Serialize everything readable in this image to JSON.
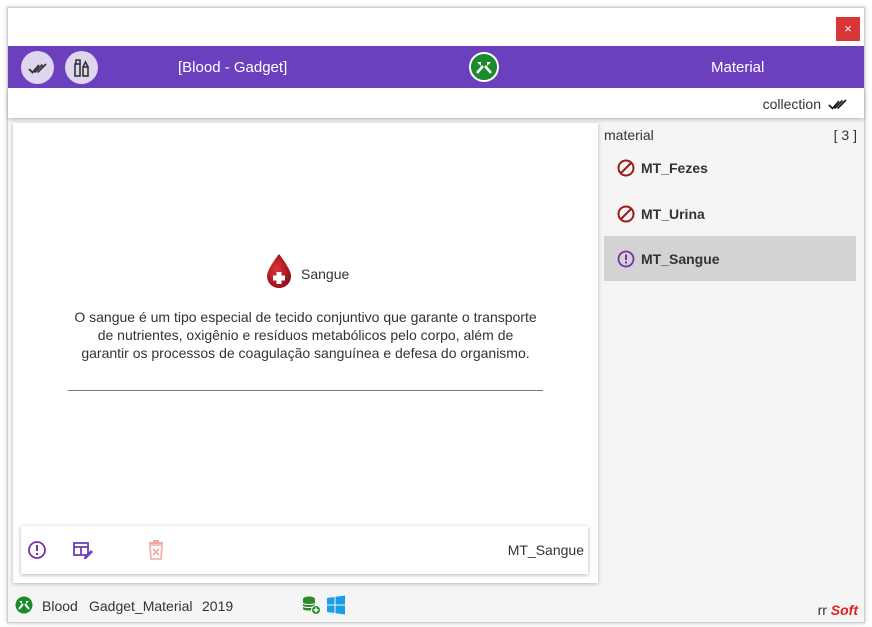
{
  "titlebar": {
    "close_label": "×"
  },
  "header": {
    "title": "[Blood - Gadget]",
    "right_label": "Material",
    "icons": [
      "double-check-icon",
      "tools-icon",
      "app-logo-icon"
    ]
  },
  "collection": {
    "label": "collection",
    "icon": "double-check-icon"
  },
  "item": {
    "name": "Sangue",
    "description": "O sangue é um tipo especial de tecido conjuntivo que garante o transporte de nutrientes, oxigênio e resíduos metabólicos pelo corpo, além de garantir os processos de coagulação sanguínea e defesa do organismo.",
    "icon": "blood-drop-icon"
  },
  "actions": {
    "label": "MT_Sangue",
    "icons": [
      "alert-circle-icon",
      "table-edit-icon",
      "delete-icon"
    ]
  },
  "side": {
    "title": "material",
    "count": "[ 3 ]",
    "items": [
      {
        "label": "MT_Fezes",
        "icon": "blocked-icon"
      },
      {
        "label": "MT_Urina",
        "icon": "blocked-icon"
      },
      {
        "label": "MT_Sangue",
        "icon": "alert-circle-icon"
      }
    ]
  },
  "footer": {
    "app": "Blood",
    "module": "Gadget_Material",
    "year": "2019",
    "brand_prefix": "rr",
    "brand_name": "Soft"
  },
  "colors": {
    "header": "#6b3fbe",
    "accent_purple": "#7b2fa8",
    "blocked_red": "#9b1b1b",
    "close_red": "#d9343a",
    "logo_green": "#1a8a2a",
    "db_green": "#2a8a2a",
    "windows_blue": "#1a9ee8",
    "selected_bg": "#d3d3d3"
  }
}
